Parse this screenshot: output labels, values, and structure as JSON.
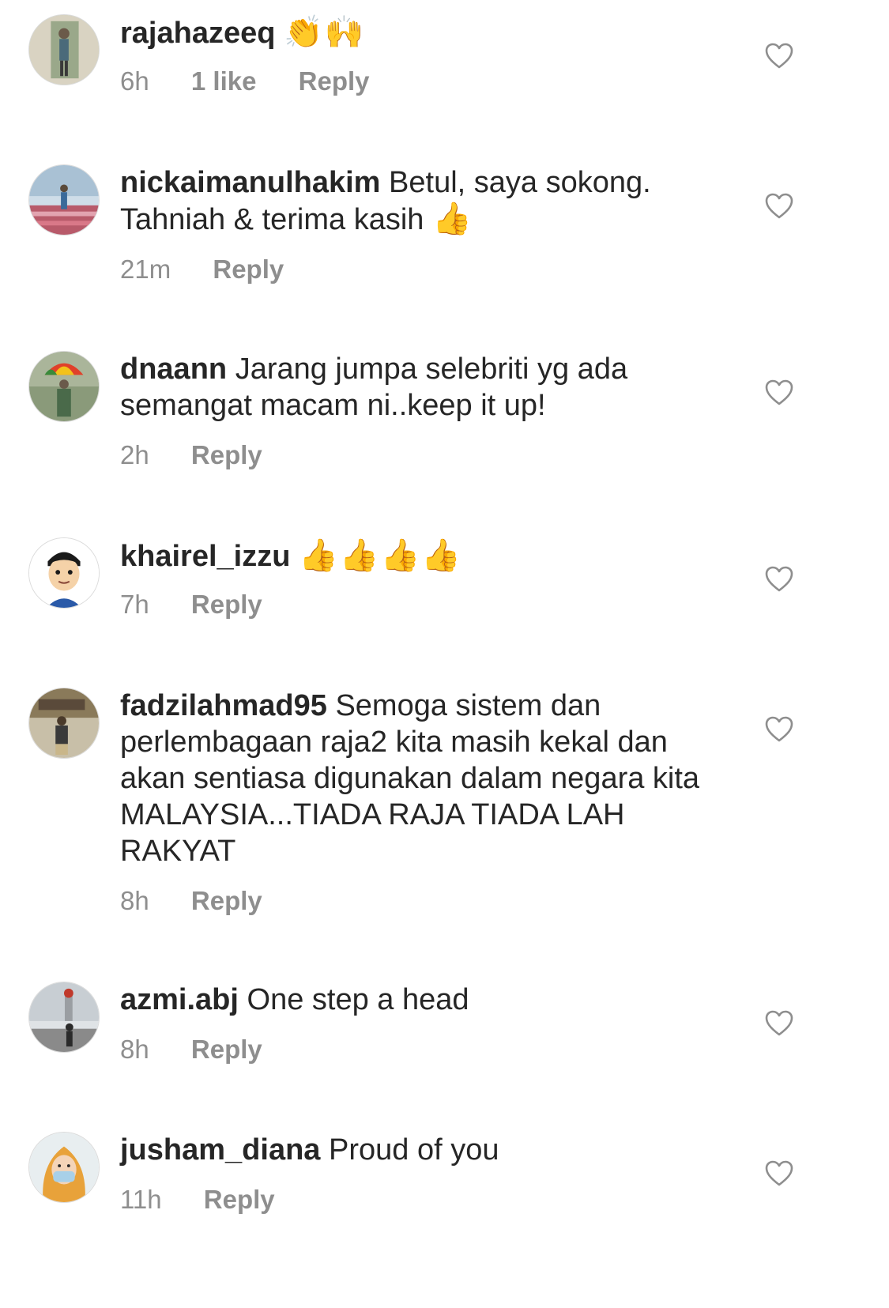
{
  "comments": [
    {
      "username": "rajahazeeq",
      "text": "",
      "emoji": "👏🙌",
      "time": "6h",
      "likes": "1 like",
      "reply": "Reply"
    },
    {
      "username": "nickaimanulhakim",
      "text": "Betul, saya sokong. Tahniah & terima kasih",
      "emoji": "👍",
      "time": "21m",
      "likes": "",
      "reply": "Reply"
    },
    {
      "username": "dnaann",
      "text": "Jarang jumpa selebriti yg ada semangat macam ni..keep it up!",
      "emoji": "",
      "time": "2h",
      "likes": "",
      "reply": "Reply"
    },
    {
      "username": "khairel_izzu",
      "text": "",
      "emoji": "👍👍👍👍",
      "time": "7h",
      "likes": "",
      "reply": "Reply"
    },
    {
      "username": "fadzilahmad95",
      "text": "Semoga sistem dan perlembagaan  raja2 kita masih kekal dan akan sentiasa digunakan dalam negara kita MALAYSIA...TIADA RAJA TIADA LAH RAKYAT",
      "emoji": "",
      "time": "8h",
      "likes": "",
      "reply": "Reply"
    },
    {
      "username": "azmi.abj",
      "text": "One step a head",
      "emoji": "",
      "time": "8h",
      "likes": "",
      "reply": "Reply"
    },
    {
      "username": "jusham_diana",
      "text": "Proud of you",
      "emoji": "",
      "time": "11h",
      "likes": "",
      "reply": "Reply"
    }
  ],
  "icons": {
    "like": "heart-outline-icon"
  },
  "colors": {
    "text": "#262626",
    "meta": "#8e8e8e",
    "heart": "#8e8e8e",
    "emoji": "#f2b632"
  }
}
